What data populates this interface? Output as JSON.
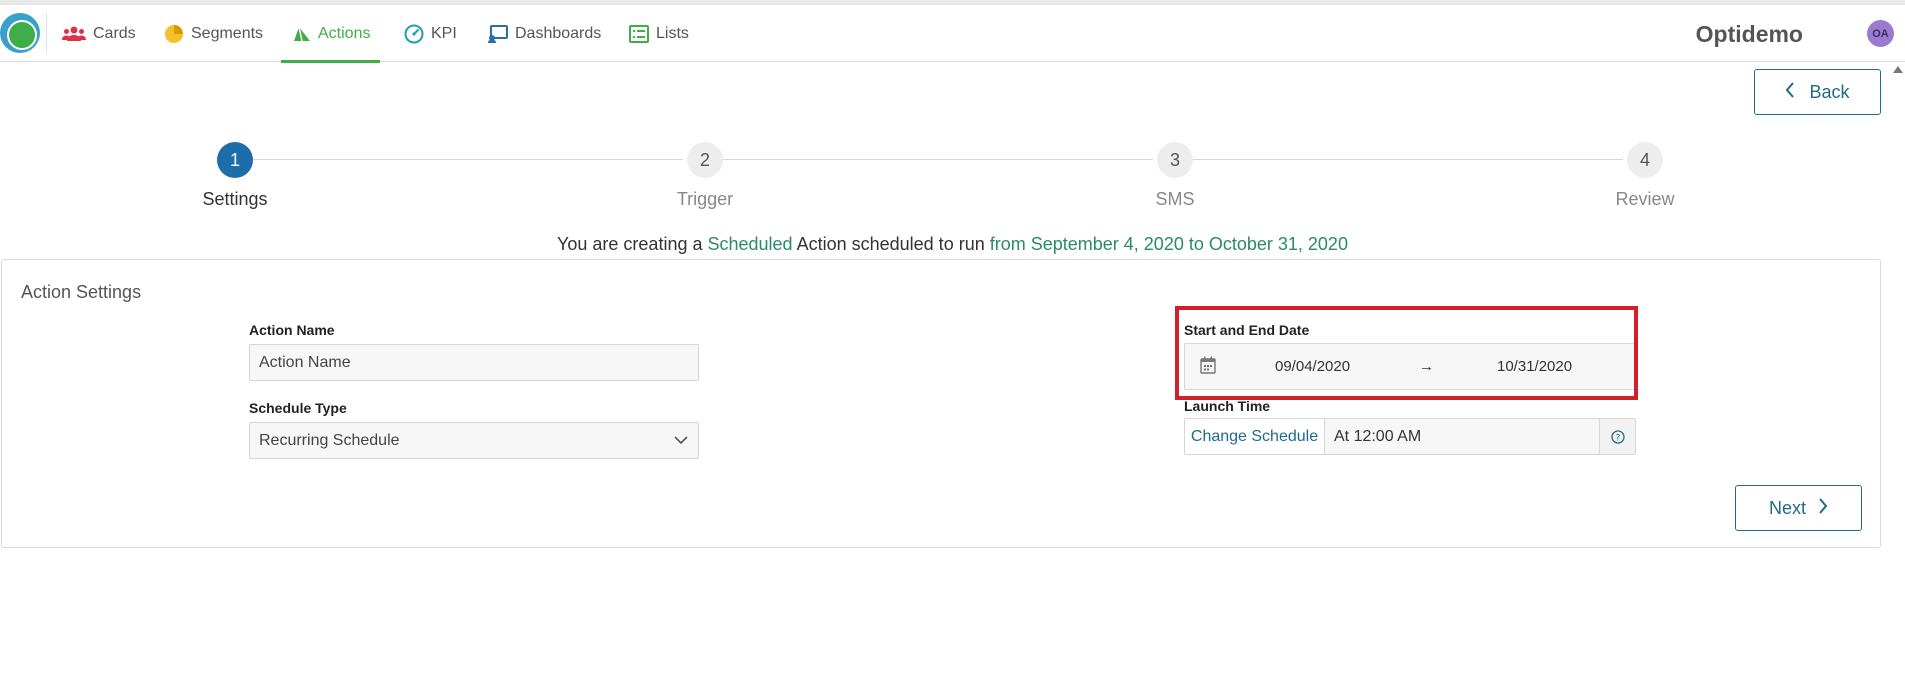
{
  "nav": {
    "items": [
      {
        "label": "Cards",
        "icon": "users-icon"
      },
      {
        "label": "Segments",
        "icon": "pie-chart-icon"
      },
      {
        "label": "Actions",
        "icon": "paper-plane-icon",
        "active": true
      },
      {
        "label": "KPI",
        "icon": "gauge-icon"
      },
      {
        "label": "Dashboards",
        "icon": "dashboard-icon"
      },
      {
        "label": "Lists",
        "icon": "list-icon"
      }
    ],
    "brand": "Optidemo",
    "avatar": "OA",
    "active_color": "#3fae49"
  },
  "back_label": "Back",
  "steps": [
    {
      "number": "1",
      "label": "Settings",
      "active": true
    },
    {
      "number": "2",
      "label": "Trigger"
    },
    {
      "number": "3",
      "label": "SMS"
    },
    {
      "number": "4",
      "label": "Review"
    }
  ],
  "summary": {
    "prefix": "You are creating a",
    "type": "Scheduled",
    "middle": "Action scheduled to run",
    "range": "from September 4, 2020 to October 31, 2020"
  },
  "panel": {
    "title": "Action Settings",
    "action_name": {
      "label": "Action Name",
      "value": "Action Name"
    },
    "schedule_type": {
      "label": "Schedule Type",
      "value": "Recurring Schedule"
    },
    "date_range": {
      "label": "Start and End Date",
      "start": "09/04/2020",
      "arrow": "→",
      "end": "10/31/2020"
    },
    "launch_time": {
      "label": "Launch Time",
      "change_label": "Change Schedule",
      "value": "At 12:00 AM"
    },
    "next_label": "Next"
  }
}
